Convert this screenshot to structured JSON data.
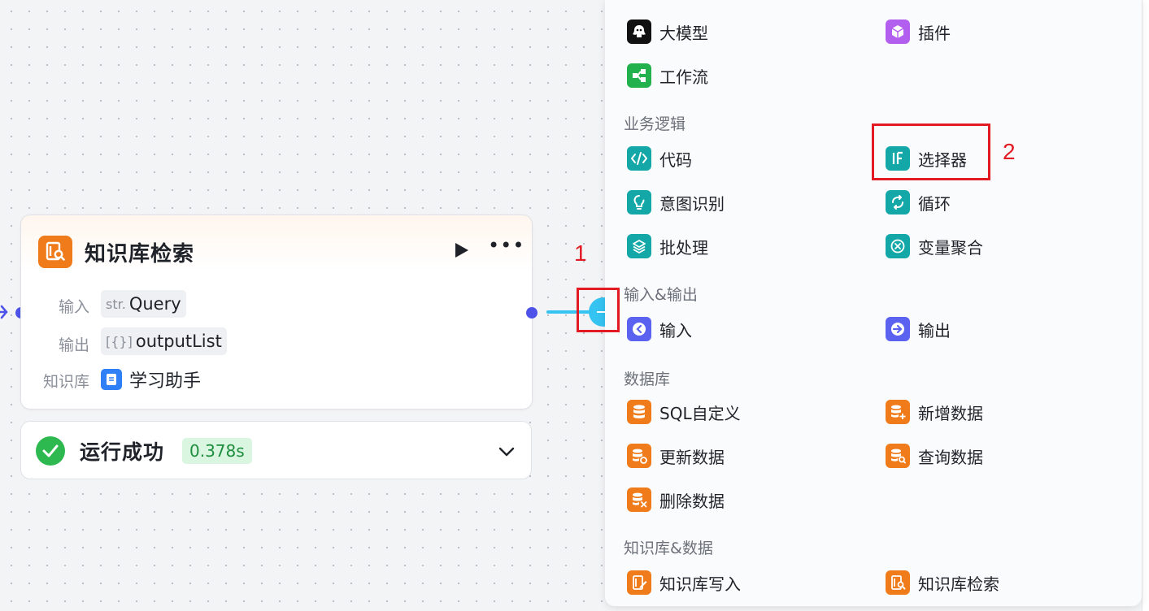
{
  "node": {
    "title": "知识库检索",
    "input_label": "输入",
    "input_type": "str.",
    "input_value": "Query",
    "output_label": "输出",
    "output_type": "[{}]",
    "output_value": "outputList",
    "kb_label": "知识库",
    "kb_value": "学习助手"
  },
  "status": {
    "text": "运行成功",
    "time": "0.378s"
  },
  "annotations": {
    "first": "1",
    "second": "2"
  },
  "panel": {
    "top_items": [
      {
        "label": "大模型",
        "icon": "llm-icon",
        "color": "#111111"
      },
      {
        "label": "插件",
        "icon": "plugin-cube-icon",
        "color": "#b25ff0"
      },
      {
        "label": "工作流",
        "icon": "workflow-icon",
        "color": "#22b14c"
      }
    ],
    "sections": [
      {
        "title": "业务逻辑",
        "items": [
          {
            "label": "代码",
            "icon": "code-icon",
            "color": "#13a7a8"
          },
          {
            "label": "选择器",
            "icon": "if-selector-icon",
            "color": "#13a7a8"
          },
          {
            "label": "意图识别",
            "icon": "intent-bulb-icon",
            "color": "#13a7a8"
          },
          {
            "label": "循环",
            "icon": "loop-icon",
            "color": "#13a7a8"
          },
          {
            "label": "批处理",
            "icon": "batch-layers-icon",
            "color": "#13a7a8"
          },
          {
            "label": "变量聚合",
            "icon": "variable-merge-icon",
            "color": "#13a7a8"
          }
        ]
      },
      {
        "title": "输入&输出",
        "items": [
          {
            "label": "输入",
            "icon": "input-icon",
            "color": "#5c62f0"
          },
          {
            "label": "输出",
            "icon": "output-icon",
            "color": "#5c62f0"
          }
        ]
      },
      {
        "title": "数据库",
        "items": [
          {
            "label": "SQL自定义",
            "icon": "database-icon",
            "color": "#f07b1a"
          },
          {
            "label": "新增数据",
            "icon": "database-add-icon",
            "color": "#f07b1a"
          },
          {
            "label": "更新数据",
            "icon": "database-update-icon",
            "color": "#f07b1a"
          },
          {
            "label": "查询数据",
            "icon": "database-query-icon",
            "color": "#f07b1a"
          },
          {
            "label": "删除数据",
            "icon": "database-delete-icon",
            "color": "#f07b1a"
          }
        ]
      },
      {
        "title": "知识库&数据",
        "items": [
          {
            "label": "知识库写入",
            "icon": "knowledge-write-icon",
            "color": "#f07b1a"
          },
          {
            "label": "知识库检索",
            "icon": "knowledge-search-icon",
            "color": "#f07b1a"
          }
        ]
      }
    ]
  }
}
